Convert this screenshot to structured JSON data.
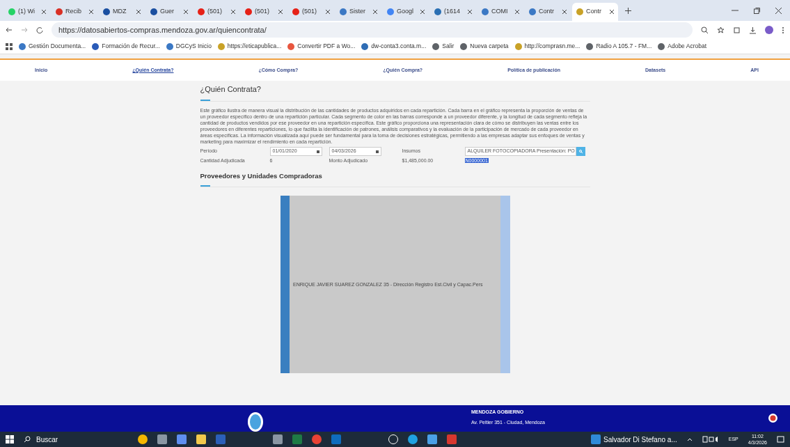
{
  "browser": {
    "tabs": [
      {
        "label": "(1) Wi",
        "selected": false,
        "color": "#25d366"
      },
      {
        "label": "Recib",
        "selected": false,
        "color": "#d93025"
      },
      {
        "label": "MDZ",
        "selected": false,
        "color": "#1a4fa0"
      },
      {
        "label": "Guer",
        "selected": false,
        "color": "#1a4fa0"
      },
      {
        "label": "(501)",
        "selected": false,
        "color": "#e62117"
      },
      {
        "label": "(501)",
        "selected": false,
        "color": "#e62117"
      },
      {
        "label": "(501)",
        "selected": false,
        "color": "#e62117"
      },
      {
        "label": "Sister",
        "selected": false,
        "color": "#3b78c4"
      },
      {
        "label": "Googl",
        "selected": false,
        "color": "#4285f4"
      },
      {
        "label": "(1614",
        "selected": false,
        "color": "#2a6fb3"
      },
      {
        "label": "COMI",
        "selected": false,
        "color": "#3b78c4"
      },
      {
        "label": "Contr",
        "selected": false,
        "color": "#3b78c4"
      },
      {
        "label": "Contr",
        "selected": true,
        "color": "#c9a227"
      }
    ],
    "url": "https://datosabiertos-compras.mendoza.gov.ar/quiencontrata/",
    "bookmarks": [
      {
        "label": "Gestión Documenta...",
        "color": "#3b78c4"
      },
      {
        "label": "Formación de Recur...",
        "color": "#2a5bb8"
      },
      {
        "label": "DGCyS Inicio",
        "color": "#3b78c4"
      },
      {
        "label": "https://eticapublica...",
        "color": "#c9a227"
      },
      {
        "label": "Convertir PDF a Wo...",
        "color": "#e8563f"
      },
      {
        "label": "dw-conta3.conta.m...",
        "color": "#2f6db5"
      },
      {
        "label": "Salir",
        "color": "#5f6368"
      },
      {
        "label": "Nueva carpeta",
        "color": "#5f6368"
      },
      {
        "label": "http://comprasn.me...",
        "color": "#c9a227"
      },
      {
        "label": "Radio A 105.7 - FM...",
        "color": "#5f6368"
      },
      {
        "label": "Adobe Acrobat",
        "color": "#5f6368"
      }
    ]
  },
  "nav": [
    {
      "label": "Inicio",
      "selected": false
    },
    {
      "label": "¿Quién Contrata?",
      "selected": true
    },
    {
      "label": "¿Cómo Compra?",
      "selected": false
    },
    {
      "label": "¿Quién Compra?",
      "selected": false
    },
    {
      "label": "Política de publicación",
      "selected": false
    },
    {
      "label": "Datasets",
      "selected": false
    },
    {
      "label": "API",
      "selected": false
    }
  ],
  "page": {
    "title": "¿Quién Contrata?",
    "description": "Este gráfico ilustra de manera visual la distribución de las cantidades de productos adquiridos en cada repartición. Cada barra en el gráfico representa la proporción de ventas de un proveedor específico dentro de una repartición particular. Cada segmento de color en las barras corresponde a un proveedor diferente, y la longitud de cada segmento refleja la cantidad de productos vendidos por ese proveedor en una repartición específica. Este gráfico proporciona una representación clara de cómo se distribuyen las ventas entre los proveedores en diferentes reparticiones, lo que facilita la identificación de patrones, análisis comparativos y la evaluación de la participación de mercado de cada proveedor en áreas específicas. La información visualizada aquí puede ser fundamental para la toma de decisiones estratégicas, permitiendo a las empresas adaptar sus enfoques de ventas y marketing para maximizar el rendimiento en cada repartición.",
    "period_label": "Período",
    "date_from": "01/01/2020",
    "date_to": "04/03/2026",
    "supplies_label": "Insumos",
    "supplies_value": "ALQUILER FOTOCOPIADORA Presentación: PO",
    "quantity_label": "Cantidad Adjudicada",
    "quantity_value": "6",
    "amount_label": "Monto Adjudicado",
    "amount_value": "$1,485,000.00",
    "selected_code": "N0000001",
    "section_title": "Proveedores y Unidades Compradoras",
    "sankey": {
      "source": "ENRIQUE JAVIER SUAREZ GONZALEZ",
      "target": "35 - Dirección Registro Est.Civil y Capac.Pers"
    }
  },
  "footer": {
    "name": "MENDOZA GOBIERNO",
    "address": "Av. Peltier 351 - Ciudad, Mendoza"
  },
  "taskbar": {
    "search_placeholder": "Buscar",
    "window_label": "Salvador Di Stefano a...",
    "language": "ESP",
    "time": "11:02",
    "date": "4/3/2026"
  }
}
